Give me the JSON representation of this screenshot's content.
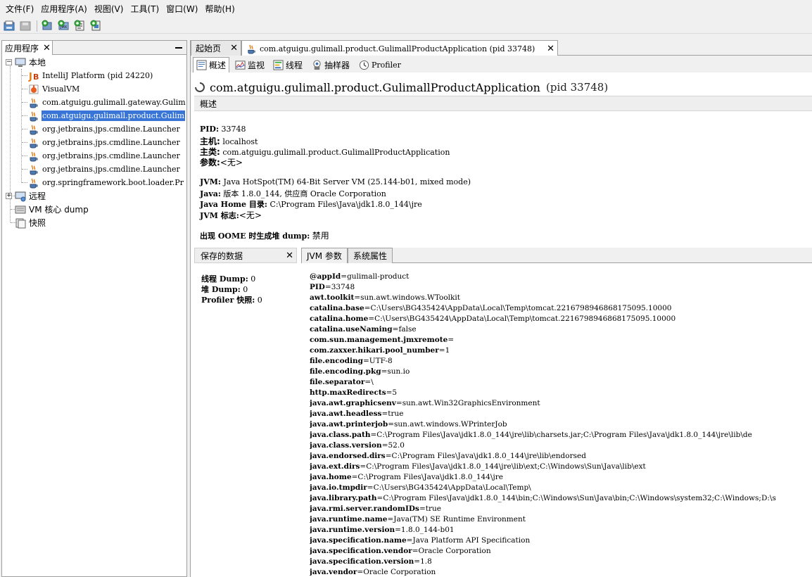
{
  "menubar": {
    "items": [
      "文件(F)",
      "应用程序(A)",
      "视图(V)",
      "工具(T)",
      "窗口(W)",
      "帮助(H)"
    ]
  },
  "toolbar": {
    "icons": [
      "open-icon",
      "save-icon",
      "add-jmx-icon",
      "add-core-dump-icon",
      "add-heap-dump-icon",
      "add-snapshot-icon"
    ]
  },
  "left_panel": {
    "tab_label": "应用程序",
    "tree": {
      "local": "本地",
      "local_items": [
        "IntelliJ Platform (pid 24220)",
        "VisualVM",
        "com.atguigu.gulimall.gateway.Gulim",
        "com.atguigu.gulimall.product.Gulim",
        "org.jetbrains.jps.cmdline.Launcher",
        "org.jetbrains.jps.cmdline.Launcher",
        "org.jetbrains.jps.cmdline.Launcher",
        "org.jetbrains.jps.cmdline.Launcher",
        "org.springframework.boot.loader.Pr"
      ],
      "remote": "远程",
      "coredump": "VM 核心 dump",
      "snapshots": "快照"
    }
  },
  "doc_tabs": {
    "start": "起始页",
    "app": "com.atguigu.gulimall.product.GulimallProductApplication (pid 33748)"
  },
  "sub_tabs": {
    "overview": "概述",
    "monitor": "监视",
    "threads": "线程",
    "sampler": "抽样器",
    "profiler": "Profiler"
  },
  "app": {
    "name": "com.atguigu.gulimall.product.GulimallProductApplication",
    "pid": "(pid 33748)"
  },
  "overview": {
    "section_label": "概述",
    "pid_label": "PID:",
    "pid_value": "33748",
    "host_label": "主机:",
    "host_value": "localhost",
    "main_label": "主类:",
    "main_value": "com.atguigu.gulimall.product.GulimallProductApplication",
    "args_label": "参数:",
    "args_value": "<无>",
    "jvm_label": "JVM:",
    "jvm_value": "Java HotSpot(TM) 64-Bit Server VM (25.144-b01, mixed mode)",
    "java_label": "Java:",
    "java_value": "版本 1.8.0_144, 供应商 Oracle Corporation",
    "javahome_label": "Java Home 目录:",
    "javahome_value": "C:\\Program Files\\Java\\jdk1.8.0_144\\jre",
    "jvmflags_label": "JVM 标志:",
    "jvmflags_value": "<无>",
    "oome_label": "出现 OOME 时生成堆 dump:",
    "oome_value": "禁用"
  },
  "saved_data": {
    "header": "保存的数据",
    "thread_dump_label": "线程 Dump:",
    "thread_dump_value": "0",
    "heap_dump_label": "堆 Dump:",
    "heap_dump_value": "0",
    "profiler_label": "Profiler 快照:",
    "profiler_value": "0"
  },
  "props_tabs": {
    "jvm_args": "JVM 参数",
    "sys_props": "系统属性"
  },
  "system_properties": [
    {
      "k": "@appId",
      "v": "gulimall-product"
    },
    {
      "k": "PID",
      "v": "33748"
    },
    {
      "k": "awt.toolkit",
      "v": "sun.awt.windows.WToolkit"
    },
    {
      "k": "catalina.base",
      "v": "C:\\Users\\BG435424\\AppData\\Local\\Temp\\tomcat.2216798946868175095.10000"
    },
    {
      "k": "catalina.home",
      "v": "C:\\Users\\BG435424\\AppData\\Local\\Temp\\tomcat.2216798946868175095.10000"
    },
    {
      "k": "catalina.useNaming",
      "v": "false"
    },
    {
      "k": "com.sun.management.jmxremote",
      "v": ""
    },
    {
      "k": "com.zaxxer.hikari.pool_number",
      "v": "1"
    },
    {
      "k": "file.encoding",
      "v": "UTF-8"
    },
    {
      "k": "file.encoding.pkg",
      "v": "sun.io"
    },
    {
      "k": "file.separator",
      "v": "\\"
    },
    {
      "k": "http.maxRedirects",
      "v": "5"
    },
    {
      "k": "java.awt.graphicsenv",
      "v": "sun.awt.Win32GraphicsEnvironment"
    },
    {
      "k": "java.awt.headless",
      "v": "true"
    },
    {
      "k": "java.awt.printerjob",
      "v": "sun.awt.windows.WPrinterJob"
    },
    {
      "k": "java.class.path",
      "v": "C:\\Program Files\\Java\\jdk1.8.0_144\\jre\\lib\\charsets.jar;C:\\Program Files\\Java\\jdk1.8.0_144\\jre\\lib\\de"
    },
    {
      "k": "java.class.version",
      "v": "52.0"
    },
    {
      "k": "java.endorsed.dirs",
      "v": "C:\\Program Files\\Java\\jdk1.8.0_144\\jre\\lib\\endorsed"
    },
    {
      "k": "java.ext.dirs",
      "v": "C:\\Program Files\\Java\\jdk1.8.0_144\\jre\\lib\\ext;C:\\Windows\\Sun\\Java\\lib\\ext"
    },
    {
      "k": "java.home",
      "v": "C:\\Program Files\\Java\\jdk1.8.0_144\\jre"
    },
    {
      "k": "java.io.tmpdir",
      "v": "C:\\Users\\BG435424\\AppData\\Local\\Temp\\"
    },
    {
      "k": "java.library.path",
      "v": "C:\\Program Files\\Java\\jdk1.8.0_144\\bin;C:\\Windows\\Sun\\Java\\bin;C:\\Windows\\system32;C:\\Windows;D:\\s"
    },
    {
      "k": "java.rmi.server.randomIDs",
      "v": "true"
    },
    {
      "k": "java.runtime.name",
      "v": "Java(TM) SE Runtime Environment"
    },
    {
      "k": "java.runtime.version",
      "v": "1.8.0_144-b01"
    },
    {
      "k": "java.specification.name",
      "v": "Java Platform API Specification"
    },
    {
      "k": "java.specification.vendor",
      "v": "Oracle Corporation"
    },
    {
      "k": "java.specification.version",
      "v": "1.8"
    },
    {
      "k": "java.vendor",
      "v": "Oracle Corporation"
    }
  ],
  "colors": {
    "selection": "#3875d7",
    "panel_bg": "#f0f0f0",
    "border": "#a0a0a0"
  }
}
